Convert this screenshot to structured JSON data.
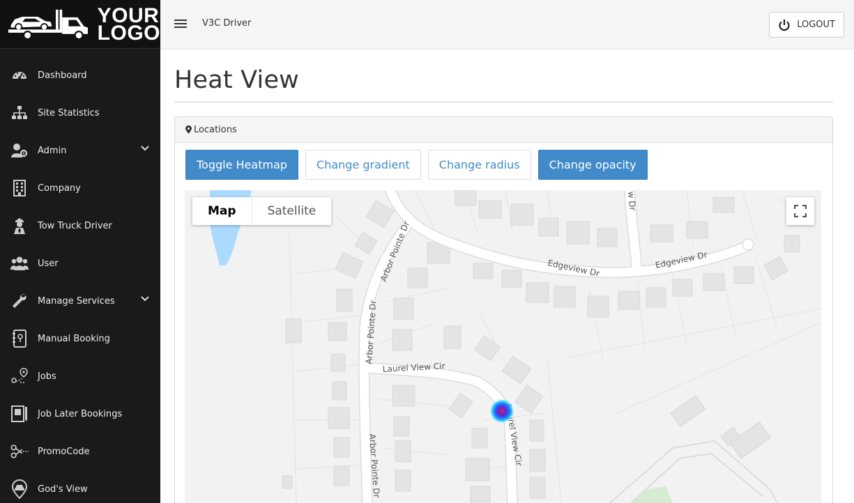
{
  "brand": {
    "logo_line1": "YOUR",
    "logo_line2": "LOGO"
  },
  "sidebar": {
    "items": [
      {
        "label": "Dashboard",
        "icon": "dashboard-icon"
      },
      {
        "label": "Site Statistics",
        "icon": "sitemap-icon"
      },
      {
        "label": "Admin",
        "icon": "admin-users-icon",
        "has_submenu": true
      },
      {
        "label": "Company",
        "icon": "building-icon"
      },
      {
        "label": "Tow Truck Driver",
        "icon": "driver-icon"
      },
      {
        "label": "User",
        "icon": "users-icon"
      },
      {
        "label": "Manage Services",
        "icon": "wrench-icon",
        "has_submenu": true
      },
      {
        "label": "Manual Booking",
        "icon": "booking-book-icon"
      },
      {
        "label": "Jobs",
        "icon": "route-pin-icon"
      },
      {
        "label": "Job Later Bookings",
        "icon": "notebook-icon"
      },
      {
        "label": "PromoCode",
        "icon": "scissors-icon"
      },
      {
        "label": "God's View",
        "icon": "map-pin-car-icon"
      }
    ]
  },
  "topbar": {
    "title": "V3C Driver",
    "logout_label": "LOGOUT"
  },
  "page": {
    "title": "Heat View"
  },
  "panel": {
    "heading": "Locations",
    "buttons": {
      "toggle": "Toggle Heatmap",
      "gradient": "Change gradient",
      "radius": "Change radius",
      "opacity": "Change opacity"
    }
  },
  "map": {
    "type_map": "Map",
    "type_satellite": "Satellite",
    "streets": {
      "edgeview_1": "Edgeview Dr",
      "edgeview_2": "Edgeview Dr",
      "arbor_1": "Arbor Pointe Dr",
      "arbor_2": "Arbor Pointe Dr",
      "arbor_3": "Arbor Pointe Dr",
      "laurel_1": "Laurel View Cir",
      "laurel_2": "Laurel View Cir",
      "top_dr": "w Dr"
    },
    "colors": {
      "water": "#aadaff",
      "road": "#ffffff",
      "block": "#e6e6e6",
      "park": "#c8e6c9",
      "heat_outer": "#00c8ff",
      "heat_inner": "#5a2ad8",
      "heat_core": "#e0205a"
    }
  }
}
